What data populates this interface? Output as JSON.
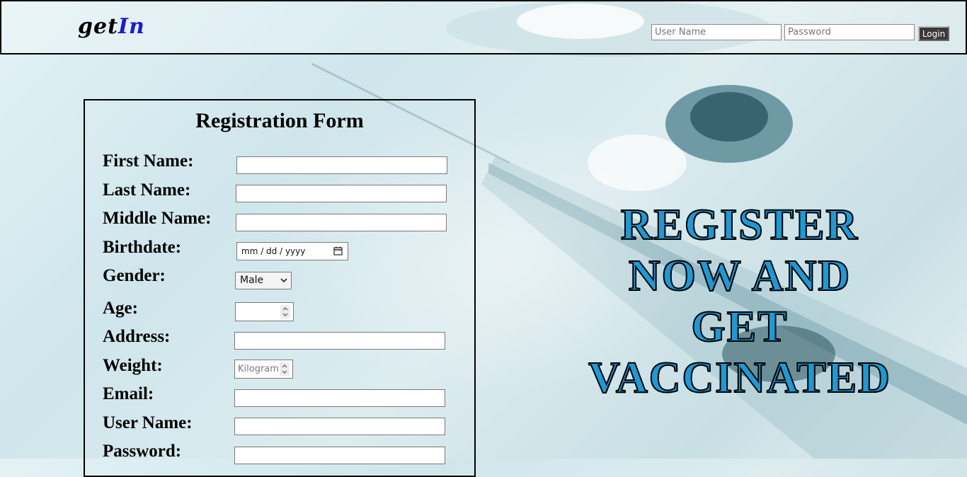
{
  "header": {
    "logo_part1": "get",
    "logo_part2": "In",
    "username_placeholder": "User Name",
    "password_placeholder": "Password",
    "login_label": "Login"
  },
  "form": {
    "title": "Registration Form",
    "fields": {
      "first_name": "First Name:",
      "last_name": "Last Name:",
      "middle_name": "Middle Name:",
      "birthdate": "Birthdate:",
      "gender": "Gender:",
      "age": "Age:",
      "address": "Address:",
      "weight": "Weight:",
      "email": "Email:",
      "user_name": "User Name:",
      "password": "Password:"
    },
    "birthdate_placeholder": "mm / dd / yyyy",
    "gender_selected": "Male",
    "weight_placeholder": "Kilograms"
  },
  "hero": {
    "line1": "REGISTER",
    "line2": "NOW AND",
    "line3": "GET",
    "line4": "VACCINATED"
  },
  "colors": {
    "logo_accent": "#1a1adb",
    "hero_fill": "#1a9ad6",
    "login_button": "#3a3a3a"
  }
}
